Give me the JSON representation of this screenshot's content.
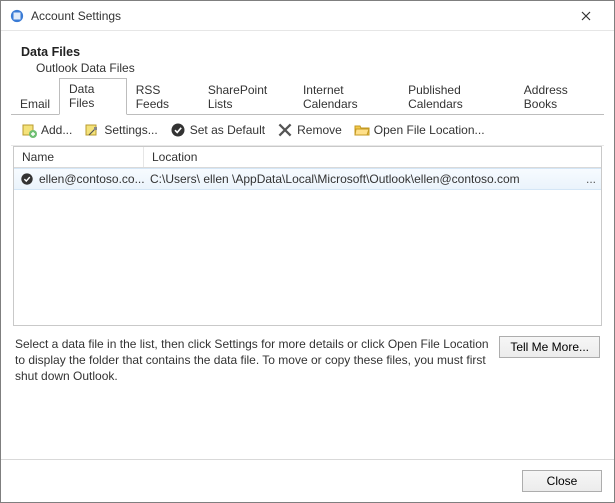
{
  "window": {
    "title": "Account Settings",
    "close_label": "Close"
  },
  "header": {
    "title": "Data Files",
    "subtitle": "Outlook Data Files"
  },
  "tabs": {
    "items": [
      {
        "label": "Email"
      },
      {
        "label": "Data Files"
      },
      {
        "label": "RSS Feeds"
      },
      {
        "label": "SharePoint Lists"
      },
      {
        "label": "Internet Calendars"
      },
      {
        "label": "Published Calendars"
      },
      {
        "label": "Address Books"
      }
    ],
    "active_index": 1
  },
  "toolbar": {
    "add": "Add...",
    "settings": "Settings...",
    "set_default": "Set as Default",
    "remove": "Remove",
    "open_location": "Open File Location..."
  },
  "columns": {
    "name": "Name",
    "location": "Location"
  },
  "rows": [
    {
      "name": "ellen@contoso.co...",
      "location": "C:\\Users\\  ellen   \\AppData\\Local\\Microsoft\\Outlook\\ellen@contoso.com",
      "is_default": true,
      "more": "..."
    }
  ],
  "help": {
    "text": "Select a data file in the list, then click Settings for more details or click Open File Location to display the folder that contains the data file. To move or copy these files, you must first shut down Outlook.",
    "tell_me_more": "Tell Me More..."
  },
  "footer": {
    "close": "Close"
  }
}
